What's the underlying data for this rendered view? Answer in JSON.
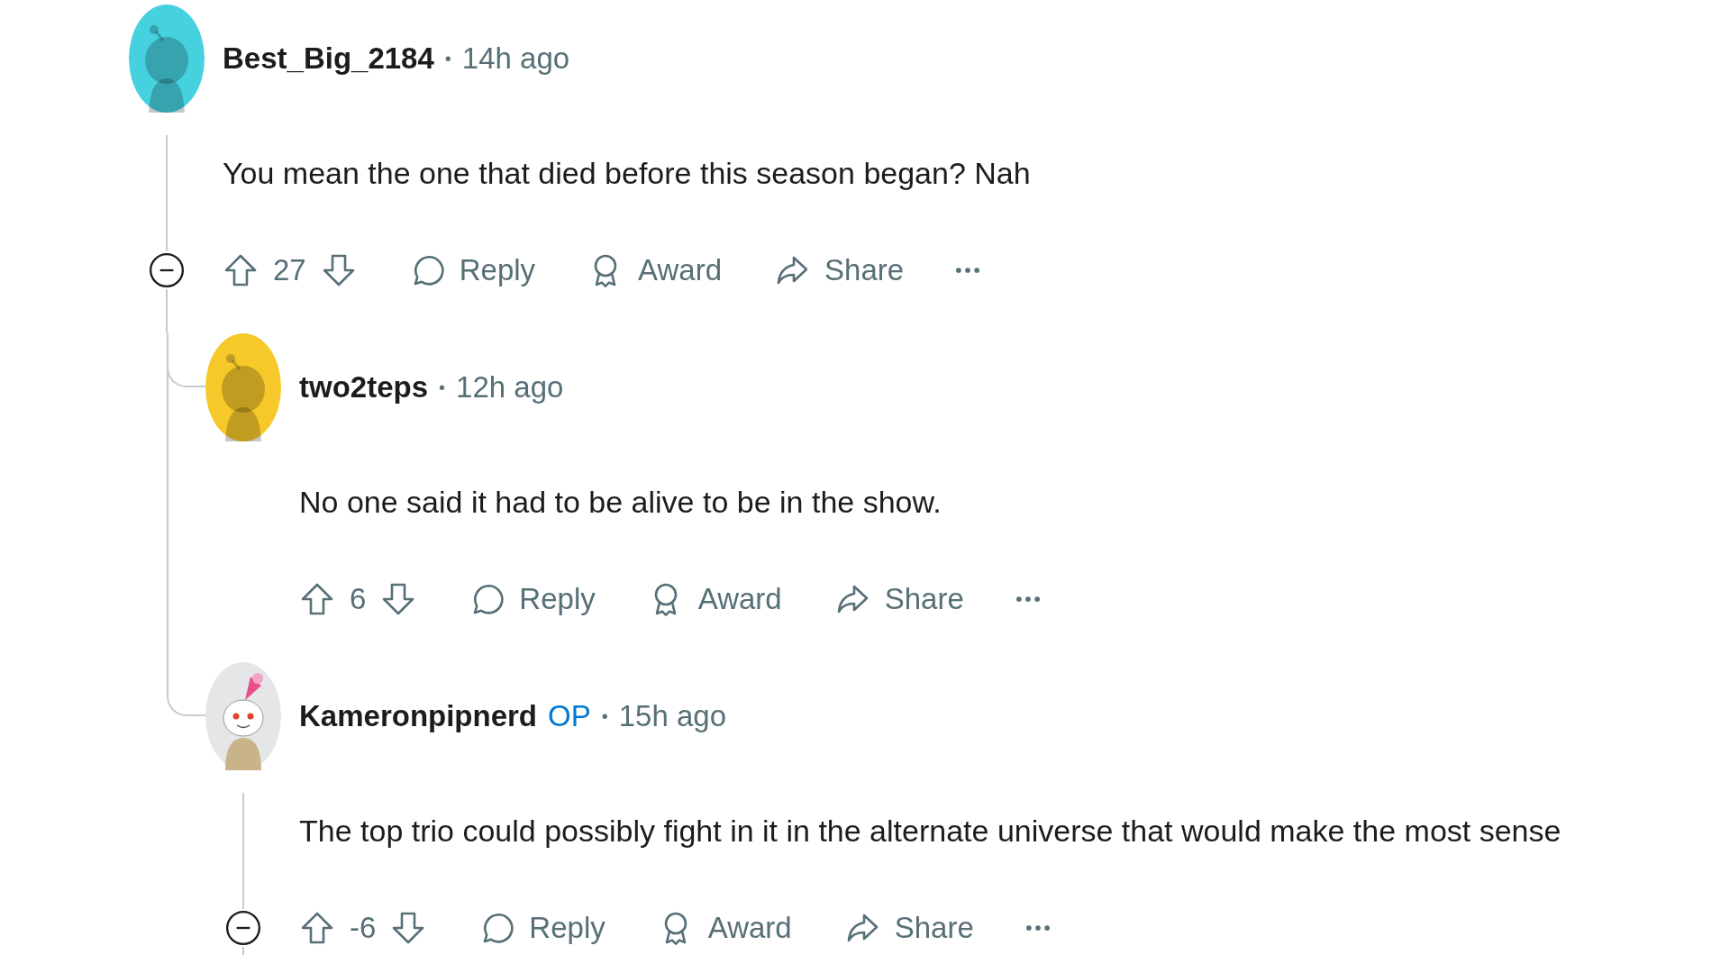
{
  "comments": [
    {
      "author": "Best_Big_2184",
      "separator": "•",
      "time": "14h ago",
      "body": "You mean the one that died before this season began? Nah",
      "score": "27",
      "avatar": {
        "kind": "default",
        "color": "#46d1df"
      },
      "collapsible": true,
      "actions": [
        {
          "kind": "reply",
          "label": "Reply"
        },
        {
          "kind": "award",
          "label": "Award"
        },
        {
          "kind": "share",
          "label": "Share"
        },
        {
          "kind": "more"
        }
      ],
      "children": [
        {
          "author": "two2teps",
          "separator": "•",
          "time": "12h ago",
          "body": "No one said it had to be alive to be in the show.",
          "score": "6",
          "avatar": {
            "kind": "default",
            "color": "#f7c82a"
          },
          "collapsible": false,
          "actions": [
            {
              "kind": "reply",
              "label": "Reply"
            },
            {
              "kind": "award",
              "label": "Award"
            },
            {
              "kind": "share",
              "label": "Share"
            },
            {
              "kind": "more"
            }
          ]
        },
        {
          "author": "Kameronpipnerd",
          "op_badge": "OP",
          "separator": "•",
          "time": "15h ago",
          "body": "The top trio could possibly fight in it in the alternate universe that would make the most sense",
          "score": "-6",
          "avatar": {
            "kind": "custom",
            "color": "#e4e6e8"
          },
          "collapsible": true,
          "actions": [
            {
              "kind": "reply",
              "label": "Reply"
            },
            {
              "kind": "award",
              "label": "Award"
            },
            {
              "kind": "share",
              "label": "Share"
            },
            {
              "kind": "more"
            }
          ]
        }
      ]
    }
  ]
}
